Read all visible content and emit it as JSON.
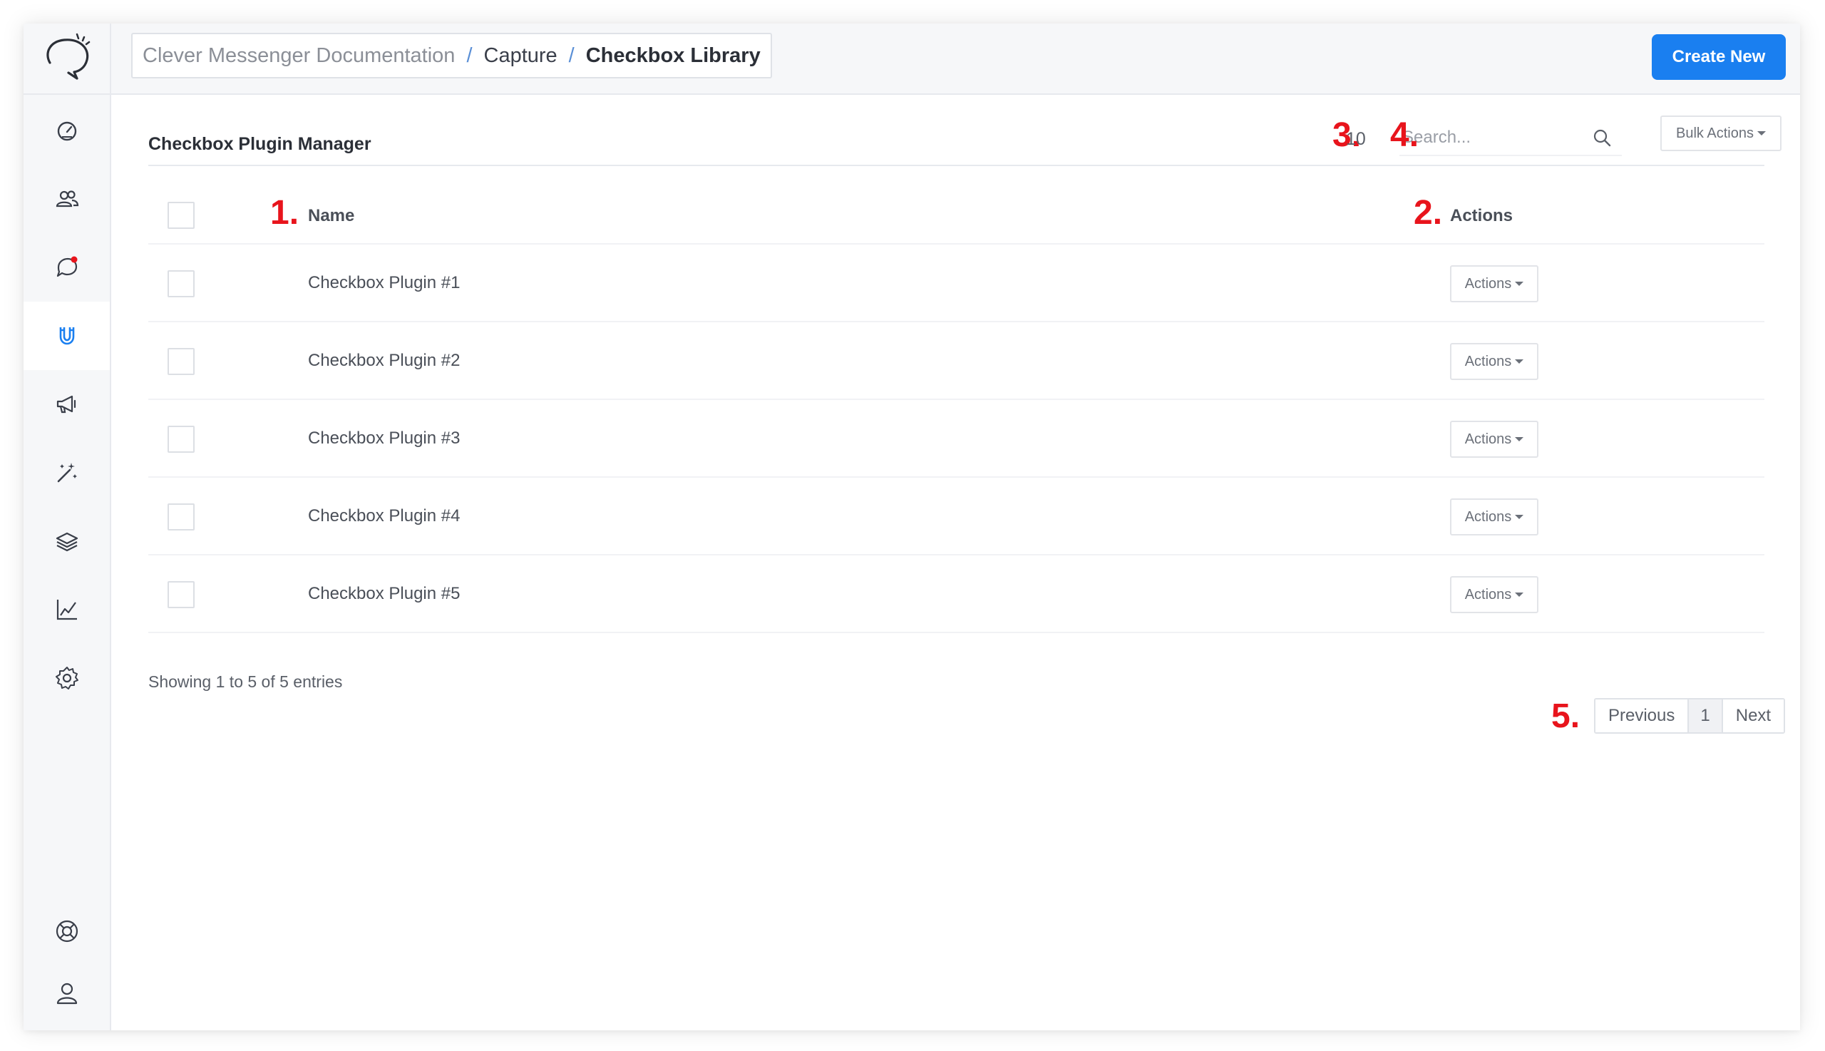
{
  "breadcrumb": {
    "items": [
      "Clever Messenger Documentation",
      "Capture",
      "Checkbox Library"
    ],
    "separator": "/"
  },
  "header": {
    "create_label": "Create New"
  },
  "sidebar": {
    "items": [
      {
        "id": "dashboard",
        "icon": "gauge-icon"
      },
      {
        "id": "users",
        "icon": "users-icon"
      },
      {
        "id": "messages",
        "icon": "chat-bubble-icon",
        "badge": true
      },
      {
        "id": "capture",
        "icon": "magnet-icon",
        "active": true
      },
      {
        "id": "broadcast",
        "icon": "megaphone-icon"
      },
      {
        "id": "automation",
        "icon": "magic-wand-icon"
      },
      {
        "id": "layers",
        "icon": "layers-icon"
      },
      {
        "id": "analytics",
        "icon": "line-chart-icon"
      },
      {
        "id": "settings",
        "icon": "gear-icon"
      },
      {
        "id": "support",
        "icon": "lifebuoy-icon"
      },
      {
        "id": "account",
        "icon": "user-icon"
      }
    ]
  },
  "panel": {
    "title": "Checkbox Plugin Manager",
    "page_length": "10",
    "search_placeholder": "Search...",
    "bulk_label": "Bulk Actions"
  },
  "annotations": [
    "1.",
    "2.",
    "3.",
    "4.",
    "5."
  ],
  "table": {
    "columns": [
      "Name",
      "Actions"
    ],
    "rows": [
      {
        "name": "Checkbox Plugin #1",
        "action": "Actions"
      },
      {
        "name": "Checkbox Plugin #2",
        "action": "Actions"
      },
      {
        "name": "Checkbox Plugin #3",
        "action": "Actions"
      },
      {
        "name": "Checkbox Plugin #4",
        "action": "Actions"
      },
      {
        "name": "Checkbox Plugin #5",
        "action": "Actions"
      }
    ]
  },
  "footer": {
    "showing": "Showing 1 to 5 of 5 entries",
    "prev": "Previous",
    "page": "1",
    "next": "Next"
  },
  "colors": {
    "primary": "#1a7ff0",
    "annotation": "#e8141c",
    "active_icon": "#1a7ff0",
    "badge": "#e8141c"
  }
}
